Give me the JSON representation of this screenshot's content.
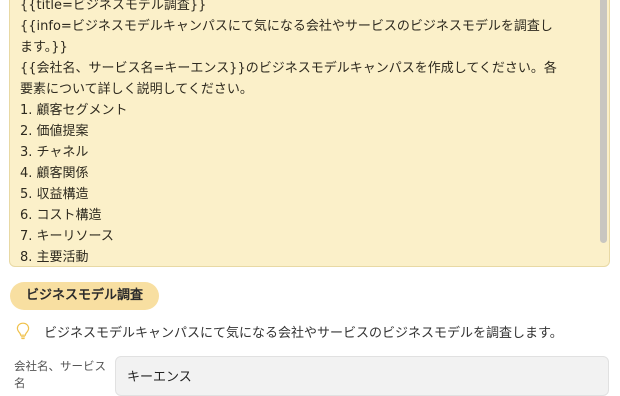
{
  "prompt": {
    "lines": [
      "{{title=ビジネスモデル調査}}",
      "{{info=ビジネスモデルキャンパスにて気になる会社やサービスのビジネスモデルを調査し",
      "ます。}}",
      "{{会社名、サービス名=キーエンス}}のビジネスモデルキャンパスを作成してください。各",
      "要素について詳しく説明してください。",
      "1. 顧客セグメント",
      "2. 価値提案",
      "3. チャネル",
      "4. 顧客関係",
      "5. 収益構造",
      "6. コスト構造",
      "7. キーリソース",
      "8. 主要活動"
    ]
  },
  "form": {
    "title": "ビジネスモデル調査",
    "info_icon": "lightbulb-icon",
    "info": "ビジネスモデルキャンパスにて気になる会社やサービスのビジネスモデルを調査します。",
    "field_label": "会社名、サービス名",
    "field_value": "キーエンス"
  },
  "colors": {
    "prompt_bg": "#fbf0c9",
    "badge_bg": "#f8dfa1"
  }
}
